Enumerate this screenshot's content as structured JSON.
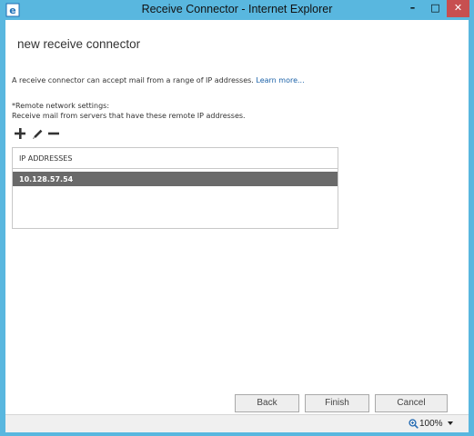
{
  "window": {
    "title": "Receive Connector - Internet Explorer",
    "app_icon": "internet-explorer-icon",
    "controls": [
      "minimize-icon",
      "maximize-icon",
      "close-icon"
    ]
  },
  "page": {
    "title": "new receive connector",
    "intro_text": "A receive connector can accept mail from a range of IP addresses.",
    "learn_more": "Learn more..."
  },
  "remote_network": {
    "label": "*Remote network settings:",
    "description": "Receive mail from servers that have these remote IP addresses.",
    "toolbar_icons": [
      "add-icon",
      "edit-icon",
      "remove-icon"
    ],
    "list_header": "IP ADDRESSES",
    "rows": [
      "10.128.57.54"
    ]
  },
  "buttons": {
    "back": "Back",
    "finish": "Finish",
    "cancel": "Cancel"
  },
  "statusbar": {
    "zoom": "100%"
  },
  "colors": {
    "frame": "#59b7df",
    "close_button": "#c74f50",
    "selected_row": "#6a6a6a",
    "link": "#1a61a8"
  }
}
